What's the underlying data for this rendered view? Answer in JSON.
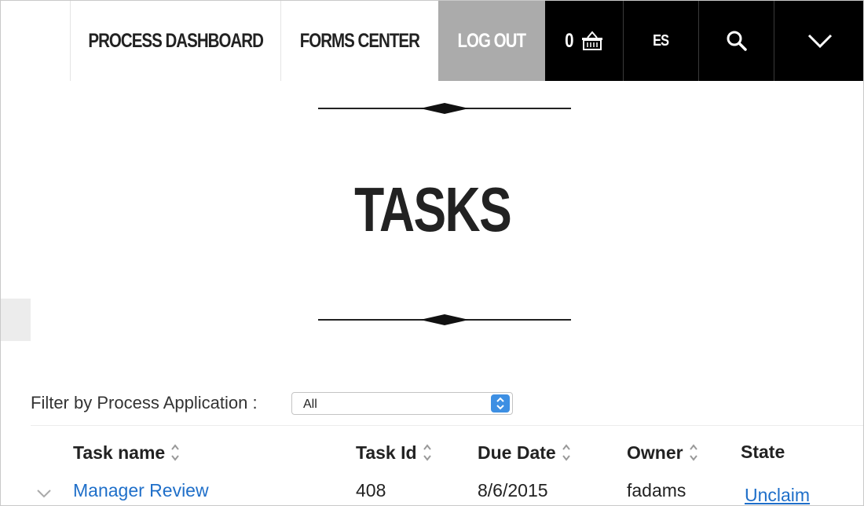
{
  "nav": {
    "process_dashboard": "PROCESS DASHBOARD",
    "forms_center": "FORMS CENTER",
    "logout": "LOG OUT",
    "cart_count": "0",
    "cart_icon": "basket-icon",
    "language": "ES",
    "search_icon": "search-icon",
    "more_icon": "chevron-down-icon"
  },
  "page": {
    "title": "TASKS"
  },
  "filter": {
    "label": "Filter by Process Application :",
    "selected": "All"
  },
  "table": {
    "columns": [
      {
        "label": "Task name",
        "sortable": true
      },
      {
        "label": "Task Id",
        "sortable": true
      },
      {
        "label": "Due Date",
        "sortable": true
      },
      {
        "label": "Owner",
        "sortable": true
      },
      {
        "label": "State",
        "sortable": false
      }
    ],
    "rows": [
      {
        "task_name": "Manager Review",
        "task_id": "408",
        "due_date": "8/6/2015",
        "owner": "fadams",
        "state_action": "Unclaim"
      }
    ]
  },
  "colors": {
    "logout_bg": "#ababab",
    "dark_nav_bg": "#000000",
    "link": "#1f6fc9",
    "select_accent": "#3d8fe3"
  }
}
